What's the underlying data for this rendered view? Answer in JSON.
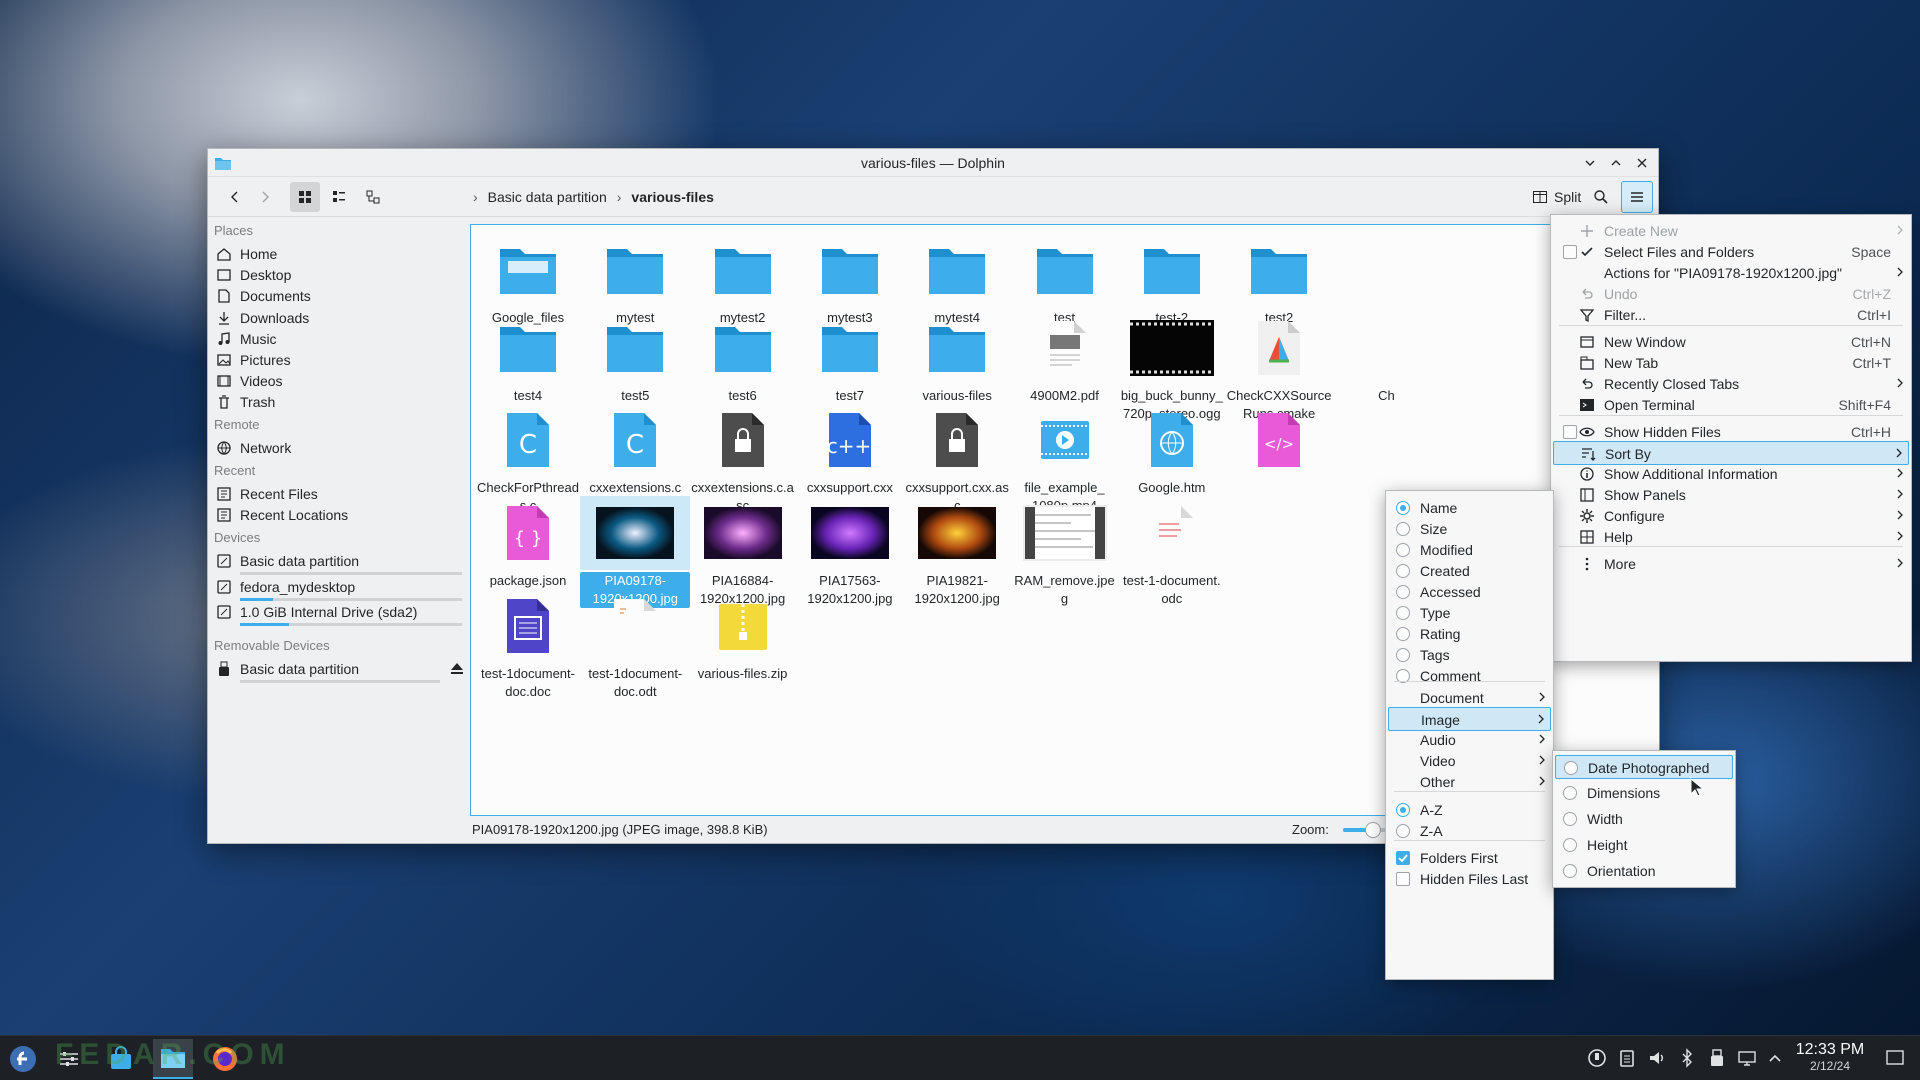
{
  "window": {
    "title": "various-files — Dolphin"
  },
  "toolbar": {
    "split_label": "Split",
    "breadcrumb": [
      "Basic data partition",
      "various-files"
    ]
  },
  "sidebar": {
    "places_header": "Places",
    "places": [
      "Home",
      "Desktop",
      "Documents",
      "Downloads",
      "Music",
      "Pictures",
      "Videos",
      "Trash"
    ],
    "remote_header": "Remote",
    "remote": [
      "Network"
    ],
    "recent_header": "Recent",
    "recent": [
      "Recent Files",
      "Recent Locations"
    ],
    "devices_header": "Devices",
    "devices": [
      "Basic data partition",
      "fedora_mydesktop",
      "1.0 GiB Internal Drive (sda2)"
    ],
    "removable_header": "Removable Devices",
    "removable": [
      "Basic data partition"
    ],
    "device_fill": [
      0.0,
      0.15,
      0.22
    ],
    "removable_fill": [
      0.0
    ]
  },
  "files": [
    [
      "Google_files",
      "mytest",
      "mytest2",
      "mytest3",
      "mytest4",
      "test",
      "test-2",
      "test2"
    ],
    [
      "test4",
      "test5",
      "test6",
      "test7",
      "various-files",
      "4900M2.pdf",
      "big_buck_bunny_\n720p_stereo.ogg",
      "CheckCXXSource\nRuns.cmake",
      "Ch"
    ],
    [
      "CheckForPthreads.c",
      "cxxextensions.c",
      "cxxextensions.c.asc",
      "cxxsupport.cxx",
      "cxxsupport.cxx.asc",
      "file_example_\n1080p.mp4",
      "Google.htm",
      ""
    ],
    [
      "package.json",
      "PIA09178-\n1920x1200.jpg",
      "PIA16884-\n1920x1200.jpg",
      "PIA17563-\n1920x1200.jpg",
      "PIA19821-\n1920x1200.jpg",
      "RAM_remove.jpeg",
      "test-1-document.\nodc"
    ],
    [
      "test-1document-\ndoc.doc",
      "test-1document-\ndoc.odt",
      "various-files.zip"
    ]
  ],
  "statusbar": {
    "text": "PIA09178-1920x1200.jpg (JPEG image, 398.8 KiB)",
    "zoom_label": "Zoom:",
    "zoom_level": 0.5
  },
  "main_menu": {
    "items": [
      {
        "label": "Create New",
        "shortcut": ""
      },
      {
        "label": "Select Files and Folders",
        "shortcut": "Space"
      },
      {
        "label": "Actions for \"PIA09178-1920x1200.jpg\"",
        "shortcut": ""
      },
      {
        "label": "Undo",
        "shortcut": "Ctrl+Z"
      },
      {
        "label": "Filter...",
        "shortcut": "Ctrl+I"
      },
      {
        "label": "New Window",
        "shortcut": "Ctrl+N"
      },
      {
        "label": "New Tab",
        "shortcut": "Ctrl+T"
      },
      {
        "label": "Recently Closed Tabs",
        "shortcut": ""
      },
      {
        "label": "Open Terminal",
        "shortcut": "Shift+F4"
      },
      {
        "label": "Show Hidden Files",
        "shortcut": "Ctrl+H"
      },
      {
        "label": "Sort By",
        "shortcut": ""
      },
      {
        "label": "Show Additional Information",
        "shortcut": ""
      },
      {
        "label": "Show Panels",
        "shortcut": ""
      },
      {
        "label": "Configure",
        "shortcut": ""
      },
      {
        "label": "Help",
        "shortcut": ""
      },
      {
        "label": "More",
        "shortcut": ""
      }
    ]
  },
  "sort_menu": {
    "items": [
      "Name",
      "Size",
      "Modified",
      "Created",
      "Accessed",
      "Type",
      "Rating",
      "Tags",
      "Comment",
      "Document",
      "Image",
      "Audio",
      "Video",
      "Other",
      "A-Z",
      "Z-A",
      "Folders First",
      "Hidden Files Last"
    ]
  },
  "image_menu": {
    "items": [
      "Date Photographed",
      "Dimensions",
      "Width",
      "Height",
      "Orientation"
    ]
  },
  "taskbar": {
    "time": "12:33 PM",
    "date": "2/12/24"
  },
  "watermark": "FEDAR.COM",
  "colors": {
    "accent": "#3daee9",
    "folder": "#3daee9",
    "panel": "#1d2126"
  }
}
